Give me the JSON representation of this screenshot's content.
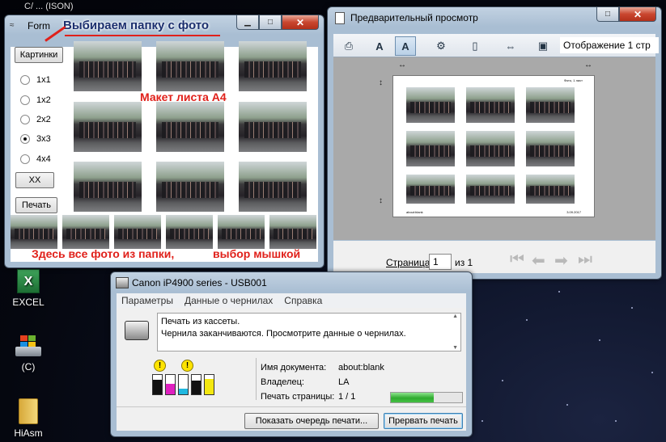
{
  "desktop": {
    "top_label": "C/ ... (ISON)",
    "icons": [
      {
        "name": "excel",
        "label": "EXCEL"
      },
      {
        "name": "drive",
        "label": "(C)"
      },
      {
        "name": "folder",
        "label": "HiAsm"
      }
    ]
  },
  "form_window": {
    "title": "Form",
    "annotation_title": "Выбираем папку с фото",
    "annotation_layout": "Макет листа А4",
    "annotation_bottom_left": "Здесь все фото из папки,",
    "annotation_bottom_right": "выбор мышкой",
    "pictures_button": "Картинки",
    "layouts": [
      "1x1",
      "1x2",
      "2x2",
      "3x3",
      "4x4"
    ],
    "selected_layout": "3x3",
    "xx_button": "XX",
    "print_button": "Печать"
  },
  "preview_window": {
    "title": "Предварительный просмотр",
    "display_label": "Отображение 1 стр",
    "page_label": "Страница",
    "page_value": "1",
    "page_total": "из 1",
    "page_header_text": "Фото, 1 лист",
    "page_footer_left": "about:blank",
    "page_footer_right": "3.09.2017"
  },
  "printer_window": {
    "title": "Canon iP4900 series - USB001",
    "menu": [
      "Параметры",
      "Данные о чернилах",
      "Справка"
    ],
    "message_line1": "Печать из кассеты.",
    "message_line2": "Чернила заканчиваются. Просмотрите данные о чернилах.",
    "doc_name_label": "Имя документа:",
    "doc_name_value": "about:blank",
    "owner_label": "Владелец:",
    "owner_value": "LA",
    "pages_label": "Печать страницы:",
    "pages_value": "1 / 1",
    "progress": 0.6,
    "queue_button": "Показать очередь печати...",
    "cancel_button": "Прервать печать",
    "ink_colors": [
      "#111111",
      "#e020c0",
      "#20b8e0",
      "#111111",
      "#f4e810"
    ],
    "ink_levels": [
      0.75,
      0.55,
      0.3,
      0.7,
      0.8
    ]
  }
}
